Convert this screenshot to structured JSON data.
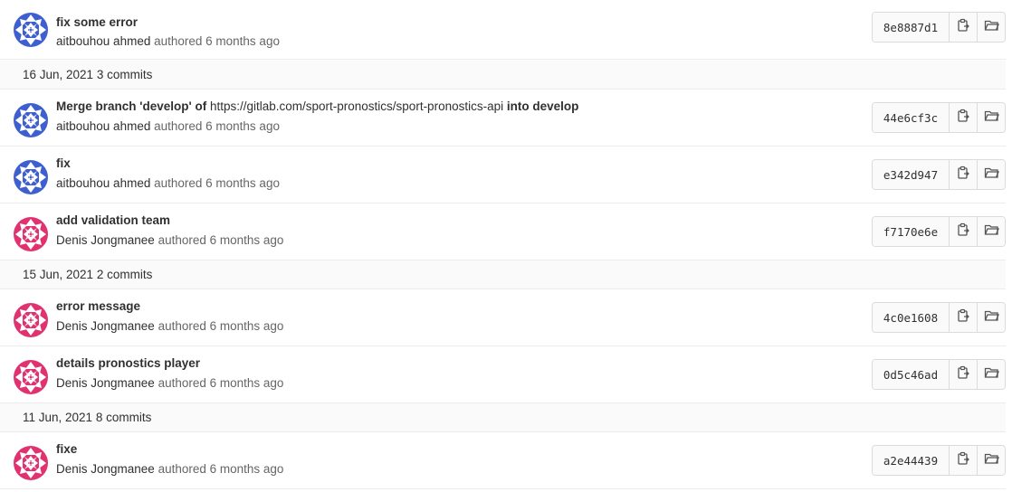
{
  "colors": {
    "blue_avatar": "#3e5fcf",
    "pink_avatar": "#e0326e",
    "border": "#dbdbdb",
    "day_bg": "#fafafa"
  },
  "commits_top": [
    {
      "title": "fix some error",
      "author": "aitbouhou ahmed",
      "authored_text": "authored 6 months ago",
      "sha": "8e8887d1",
      "avatar": "blue"
    }
  ],
  "days": [
    {
      "date": "16 Jun, 2021",
      "count": "3 commits",
      "commits": [
        {
          "title_prefix": "Merge branch 'develop' of",
          "title_url": "https://gitlab.com/sport-pronostics/sport-pronostics-api",
          "title_suffix": "into develop",
          "author": "aitbouhou ahmed",
          "authored_text": "authored 6 months ago",
          "sha": "44e6cf3c",
          "avatar": "blue"
        },
        {
          "title": "fix",
          "author": "aitbouhou ahmed",
          "authored_text": "authored 6 months ago",
          "sha": "e342d947",
          "avatar": "blue"
        },
        {
          "title": "add validation team",
          "author": "Denis Jongmanee",
          "authored_text": "authored 6 months ago",
          "sha": "f7170e6e",
          "avatar": "pink"
        }
      ]
    },
    {
      "date": "15 Jun, 2021",
      "count": "2 commits",
      "commits": [
        {
          "title": "error message",
          "author": "Denis Jongmanee",
          "authored_text": "authored 6 months ago",
          "sha": "4c0e1608",
          "avatar": "pink"
        },
        {
          "title": "details pronostics player",
          "author": "Denis Jongmanee",
          "authored_text": "authored 6 months ago",
          "sha": "0d5c46ad",
          "avatar": "pink"
        }
      ]
    },
    {
      "date": "11 Jun, 2021",
      "count": "8 commits",
      "commits": [
        {
          "title": "fixe",
          "author": "Denis Jongmanee",
          "authored_text": "authored 6 months ago",
          "sha": "a2e44439",
          "avatar": "pink"
        }
      ]
    }
  ],
  "icons": {
    "copy": "copy-icon",
    "browse": "folder-open-icon"
  }
}
